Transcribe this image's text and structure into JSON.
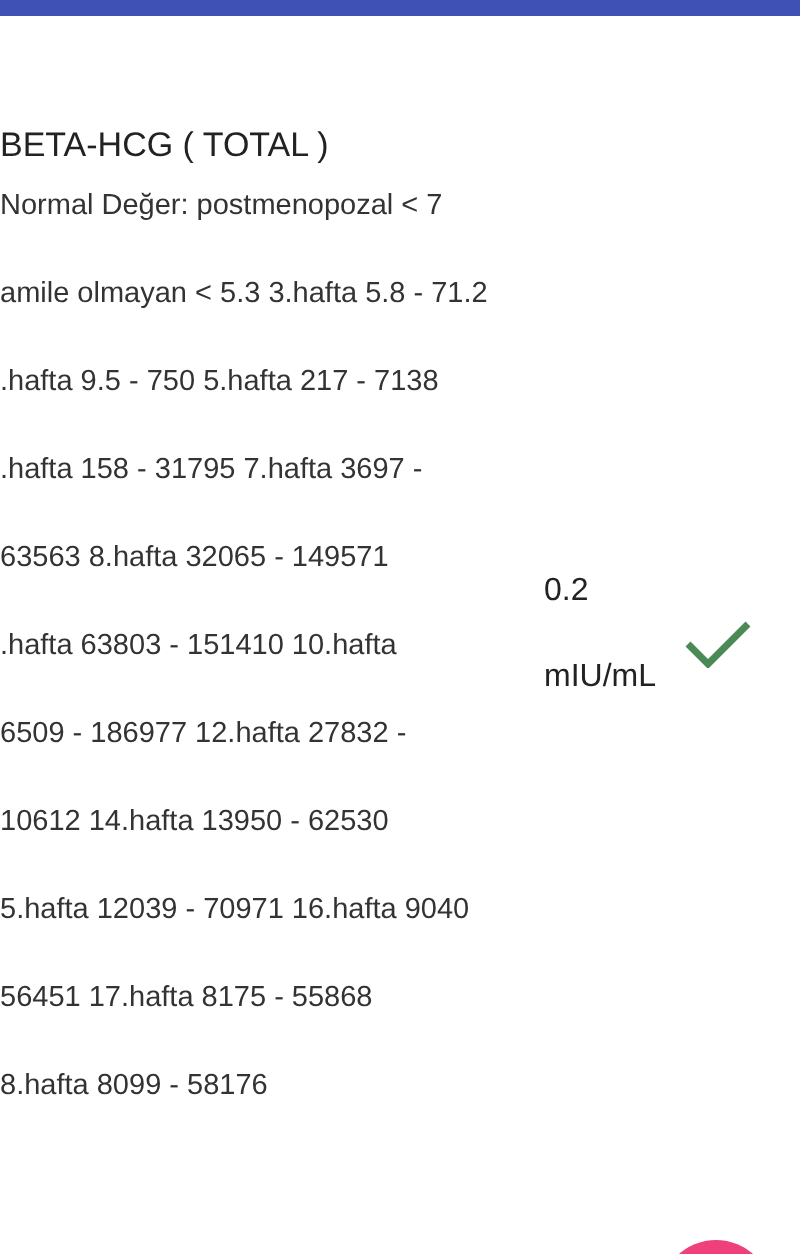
{
  "title": "BETA-HCG ( TOTAL )",
  "reference_lines": [
    "Normal Değer: postmenopozal < 7",
    "amile olmayan < 5.3 3.hafta 5.8 - 71.2",
    ".hafta 9.5 - 750 5.hafta 217 - 7138",
    ".hafta 158 - 31795 7.hafta 3697 -",
    "63563 8.hafta 32065 - 149571",
    ".hafta 63803 - 151410 10.hafta",
    "6509 - 186977 12.hafta 27832 -",
    "10612 14.hafta 13950 - 62530",
    "5.hafta 12039 - 70971 16.hafta 9040",
    "56451 17.hafta 8175 - 55868",
    "8.hafta 8099 - 58176"
  ],
  "result": {
    "value": "0.2",
    "unit": "mIU/mL",
    "in_range": true
  }
}
